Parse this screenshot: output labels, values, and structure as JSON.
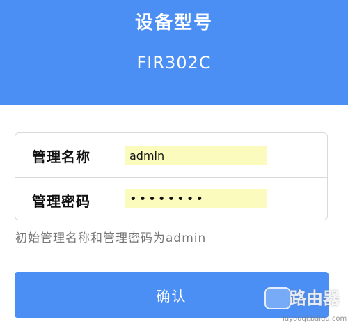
{
  "header": {
    "title": "设备型号",
    "model": "FIR302C"
  },
  "form": {
    "username": {
      "label": "管理名称",
      "value": "admin"
    },
    "password": {
      "label": "管理密码",
      "value": "admin123"
    }
  },
  "hint": "初始管理名称和管理密码为admin",
  "confirm_label": "确认",
  "watermark": {
    "text": "路由器",
    "url": "luyouqi.baidu.com"
  },
  "colors": {
    "accent": "#4b8ff4",
    "autofill": "#fcfbbe",
    "hint": "#777777"
  }
}
